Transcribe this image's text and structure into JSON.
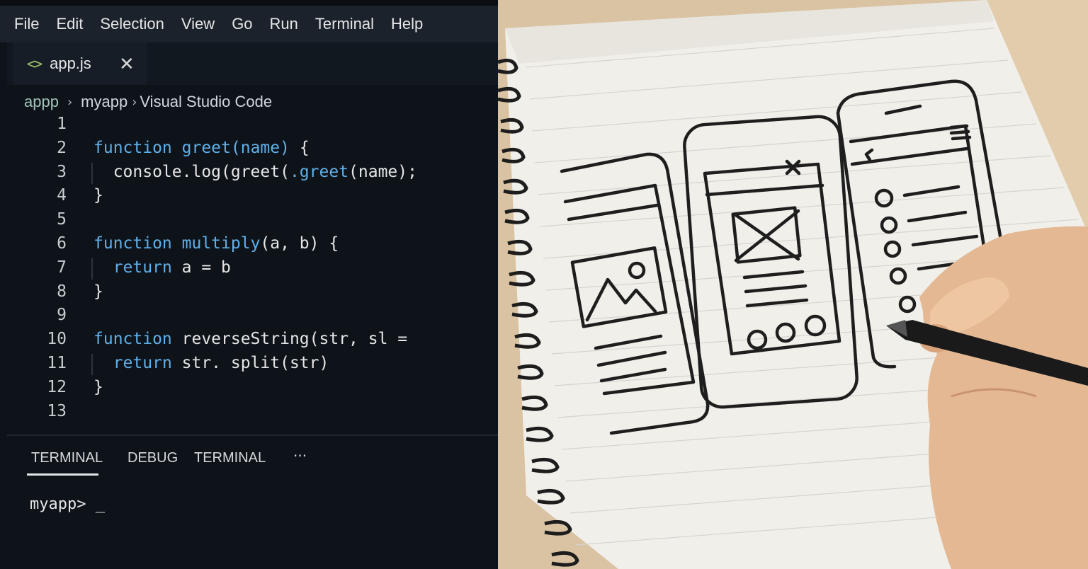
{
  "menubar": {
    "items": [
      "File",
      "Edit",
      "Selection",
      "View",
      "Go",
      "Run",
      "Terminal",
      "Help"
    ]
  },
  "tab": {
    "icon": "code-brackets-icon",
    "label": "app.js",
    "close_icon": "close-icon",
    "icon_glyph": "<>",
    "close_glyph": "✕"
  },
  "breadcrumb": {
    "items": [
      "appp",
      "myapp",
      "Visual Studio Code"
    ],
    "separator_icon": "chevron-right-icon"
  },
  "editor": {
    "lines": [
      {
        "n": "1",
        "text": ""
      },
      {
        "n": "2",
        "text": "function greet(name) {"
      },
      {
        "n": "3",
        "text": "  console.log(greet(.greet(name);"
      },
      {
        "n": "4",
        "text": "}"
      },
      {
        "n": "5",
        "text": ""
      },
      {
        "n": "6",
        "text": "function multiply(a, b) {"
      },
      {
        "n": "7",
        "text": "  return a = b"
      },
      {
        "n": "8",
        "text": "}"
      },
      {
        "n": "9",
        "text": ""
      },
      {
        "n": "10",
        "text": "function reverseString(str, sl ="
      },
      {
        "n": "11",
        "text": "  return str. split(str)"
      },
      {
        "n": "12",
        "text": "}"
      },
      {
        "n": "13",
        "text": ""
      }
    ]
  },
  "panel": {
    "tabs": [
      "TERMINAL",
      "DEBUG",
      "TERMINAL"
    ],
    "active_tab": "TERMINAL",
    "more_icon": "ellipsis-icon",
    "more_glyph": "···"
  },
  "terminal": {
    "prompt": "myapp> _"
  },
  "colors": {
    "keyword": "#5fb0e8",
    "breadcrumb_root": "#9fc4b8",
    "tab_icon": "#9fc46a"
  }
}
